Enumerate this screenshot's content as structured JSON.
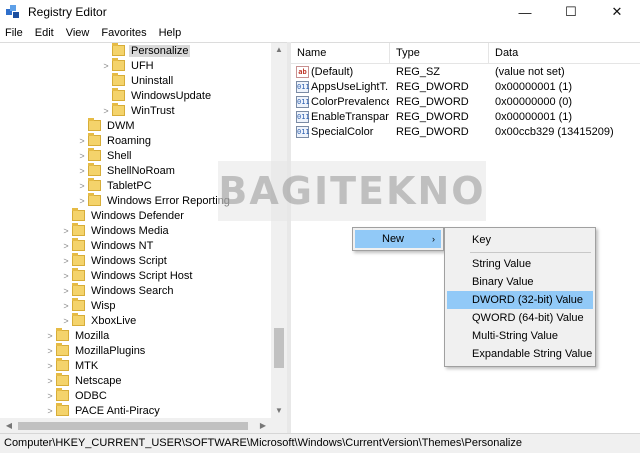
{
  "window": {
    "title": "Registry Editor",
    "minimize": "—",
    "maximize": "☐",
    "close": "✕"
  },
  "menu": [
    "File",
    "Edit",
    "View",
    "Favorites",
    "Help"
  ],
  "tree": [
    {
      "label": "Personalize",
      "selected": true
    },
    {
      "label": "UFH"
    },
    {
      "label": "Uninstall"
    },
    {
      "label": "WindowsUpdate"
    },
    {
      "label": "WinTrust"
    },
    {
      "label": "DWM"
    },
    {
      "label": "Roaming"
    },
    {
      "label": "Shell"
    },
    {
      "label": "ShellNoRoam"
    },
    {
      "label": "TabletPC"
    },
    {
      "label": "Windows Error Reporting"
    },
    {
      "label": "Windows Defender"
    },
    {
      "label": "Windows Media"
    },
    {
      "label": "Windows NT"
    },
    {
      "label": "Windows Script"
    },
    {
      "label": "Windows Script Host"
    },
    {
      "label": "Windows Search"
    },
    {
      "label": "Wisp"
    },
    {
      "label": "XboxLive"
    },
    {
      "label": "Mozilla"
    },
    {
      "label": "MozillaPlugins"
    },
    {
      "label": "MTK"
    },
    {
      "label": "Netscape"
    },
    {
      "label": "ODBC"
    },
    {
      "label": "PACE Anti-Piracy"
    }
  ],
  "list": {
    "headers": {
      "name": "Name",
      "type": "Type",
      "data": "Data"
    },
    "rows": [
      {
        "icon": "string-value-icon",
        "name": "(Default)",
        "type": "REG_SZ",
        "data": "(value not set)"
      },
      {
        "icon": "dword-value-icon",
        "name": "AppsUseLightT...",
        "type": "REG_DWORD",
        "data": "0x00000001 (1)"
      },
      {
        "icon": "dword-value-icon",
        "name": "ColorPrevalence",
        "type": "REG_DWORD",
        "data": "0x00000000 (0)"
      },
      {
        "icon": "dword-value-icon",
        "name": "EnableTranspar...",
        "type": "REG_DWORD",
        "data": "0x00000001 (1)"
      },
      {
        "icon": "dword-value-icon",
        "name": "SpecialColor",
        "type": "REG_DWORD",
        "data": "0x00ccb329 (13415209)"
      }
    ]
  },
  "watermark": "BAGITEKNO",
  "context_menu": {
    "new_label": "New",
    "arrow": "›"
  },
  "submenu": {
    "key": "Key",
    "string_value": "String Value",
    "binary_value": "Binary Value",
    "dword_value": "DWORD (32-bit) Value",
    "qword_value": "QWORD (64-bit) Value",
    "multi_string_value": "Multi-String Value",
    "expandable_string_value": "Expandable String Value"
  },
  "statusbar": {
    "path": "Computer\\HKEY_CURRENT_USER\\SOFTWARE\\Microsoft\\Windows\\CurrentVersion\\Themes\\Personalize"
  },
  "colors": {
    "highlight": "#91c9f7",
    "folder": "#f4d36b"
  }
}
